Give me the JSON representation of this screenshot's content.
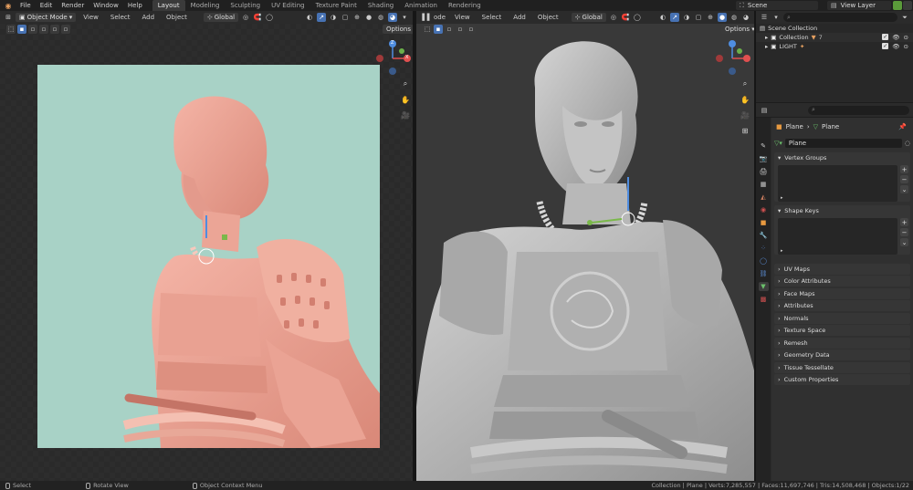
{
  "menu": {
    "items": [
      "File",
      "Edit",
      "Render",
      "Window",
      "Help"
    ],
    "workspaces": [
      "Layout",
      "Modeling",
      "Sculpting",
      "UV Editing",
      "Texture Paint",
      "Shading",
      "Animation",
      "Rendering"
    ],
    "active_workspace": "Layout",
    "scene": "Scene",
    "view_layer": "View Layer"
  },
  "left_viewport": {
    "mode": "Object Mode",
    "menus": [
      "View",
      "Select",
      "Add",
      "Object"
    ],
    "transform_orientation": "Global",
    "options_label": "Options"
  },
  "right_viewport": {
    "mode_partial": "ode",
    "menus": [
      "View",
      "Select",
      "Add",
      "Object"
    ],
    "transform_orientation": "Global",
    "options_label": "Options"
  },
  "gizmo": {
    "z_label": "Z",
    "y_label": "Y",
    "x_label": "X"
  },
  "outliner": {
    "rows": [
      {
        "label": "Scene Collection",
        "indent": 0
      },
      {
        "label": "Collection",
        "indent": 1,
        "extra": "7"
      },
      {
        "label": "LIGHT",
        "indent": 1
      }
    ]
  },
  "properties": {
    "breadcrumb_object": "Plane",
    "breadcrumb_data": "Plane",
    "data_name": "Plane",
    "open_panels": [
      "Vertex Groups",
      "Shape Keys"
    ],
    "collapsed_panels": [
      "UV Maps",
      "Color Attributes",
      "Face Maps",
      "Attributes",
      "Normals",
      "Texture Space",
      "Remesh",
      "Geometry Data",
      "Tissue Tessellate",
      "Custom Properties"
    ]
  },
  "status": {
    "select": "Select",
    "rotate": "Rotate View",
    "context": "Object Context Menu",
    "stats": "Collection | Plane | Verts:7,285,557 | Faces:11,697,746 | Tris:14,508,468 | Objects:1/22"
  },
  "colors": {
    "accent": "#4772b3",
    "render_bg": "#a8d2c6",
    "sculpt_pink": "#e99a8e",
    "clay_grey": "#b9b9b9"
  }
}
